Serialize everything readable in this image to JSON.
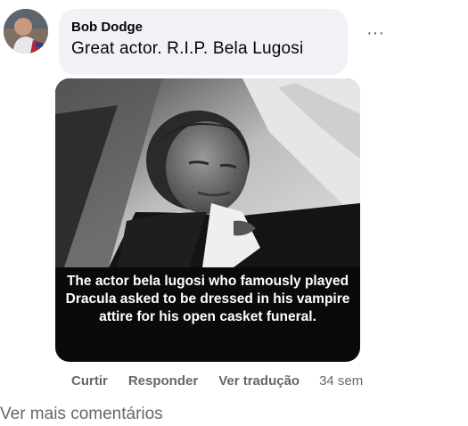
{
  "comment": {
    "author": "Bob Dodge",
    "text": "Great actor. R.I.P. Bela Lugosi",
    "more_icon": "ellipsis-icon",
    "more_label": "···"
  },
  "attachment": {
    "caption": "The actor bela lugosi who famously played Dracula asked to be dressed in his vampire attire for his open casket funeral."
  },
  "actions": {
    "like": "Curtir",
    "reply": "Responder",
    "translate": "Ver tradução",
    "timestamp": "34 sem"
  },
  "footer": {
    "view_more": "Ver mais comentários"
  },
  "colors": {
    "bubble_bg": "#f0f2f5",
    "secondary_text": "#65676b",
    "primary_text": "#050505"
  }
}
